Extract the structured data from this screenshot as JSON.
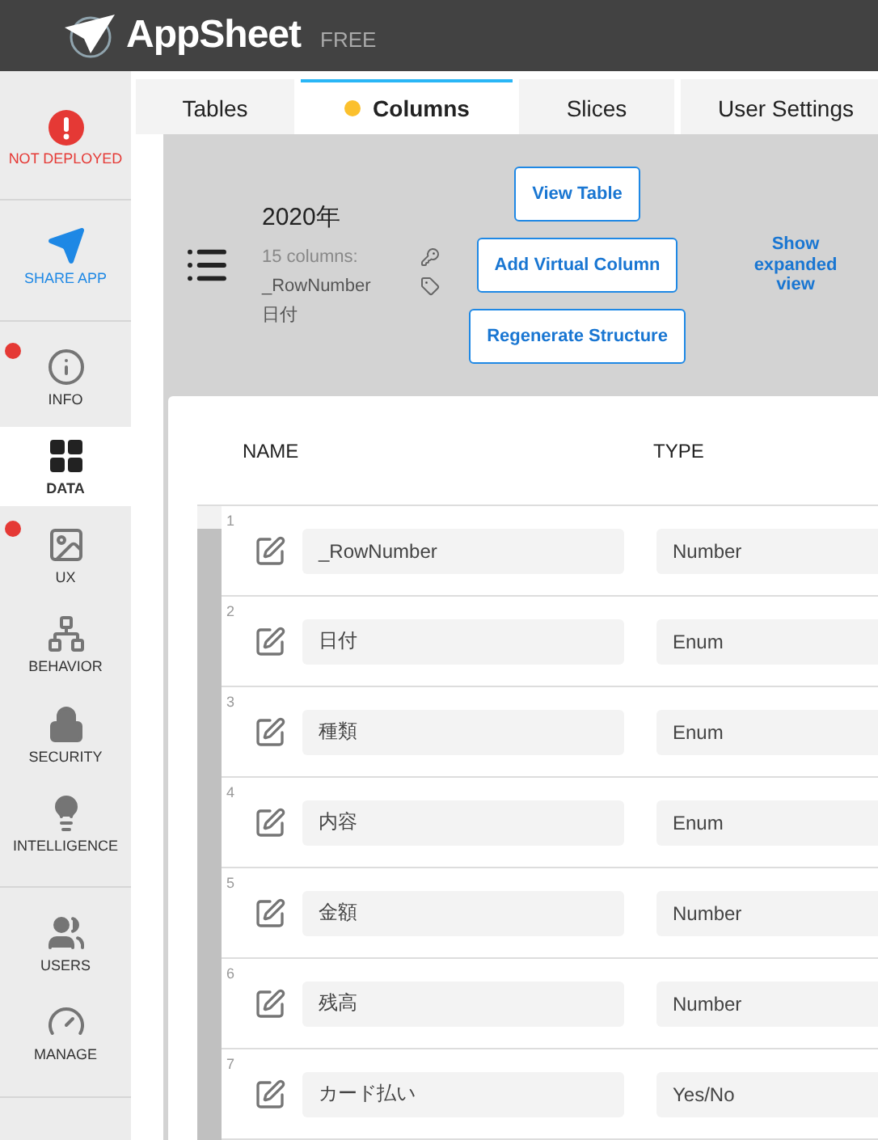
{
  "header": {
    "brand": "AppSheet",
    "plan": "FREE"
  },
  "sidebar": {
    "sections": [
      {
        "items": [
          {
            "kind": "status",
            "label": "NOT DEPLOYED",
            "selected": false,
            "alert": false
          }
        ]
      },
      {
        "items": [
          {
            "kind": "share",
            "label": "SHARE APP",
            "selected": false,
            "alert": false
          }
        ]
      },
      {
        "items": [
          {
            "kind": "info",
            "label": "INFO",
            "selected": false,
            "alert": true
          },
          {
            "kind": "data",
            "label": "DATA",
            "selected": true,
            "alert": false
          },
          {
            "kind": "ux",
            "label": "UX",
            "selected": false,
            "alert": true
          },
          {
            "kind": "behavior",
            "label": "BEHAVIOR",
            "selected": false,
            "alert": false
          },
          {
            "kind": "security",
            "label": "SECURITY",
            "selected": false,
            "alert": false
          },
          {
            "kind": "intelligence",
            "label": "INTELLIGENCE",
            "selected": false,
            "alert": false
          }
        ]
      },
      {
        "items": [
          {
            "kind": "users",
            "label": "USERS",
            "selected": false,
            "alert": false
          },
          {
            "kind": "manage",
            "label": "MANAGE",
            "selected": false,
            "alert": false
          }
        ]
      }
    ]
  },
  "tabs": [
    {
      "label": "Tables",
      "selected": false,
      "modified": false
    },
    {
      "label": "Columns",
      "selected": true,
      "modified": true
    },
    {
      "label": "Slices",
      "selected": false,
      "modified": false
    },
    {
      "label": "User Settings",
      "selected": false,
      "modified": false
    }
  ],
  "table_summary": {
    "title": "2020年",
    "count": "15 columns:",
    "key_column": "_RowNumber",
    "label_column": "日付"
  },
  "buttons": [
    "View Table",
    "Add Virtual Column",
    "Regenerate Structure"
  ],
  "expand_link": "Show expanded view",
  "columns_table": {
    "headers": [
      "NAME",
      "TYPE"
    ],
    "rows": [
      {
        "number": "1",
        "name": "_RowNumber",
        "type": "Number"
      },
      {
        "number": "2",
        "name": "日付",
        "type": "Enum"
      },
      {
        "number": "3",
        "name": "種類",
        "type": "Enum"
      },
      {
        "number": "4",
        "name": "内容",
        "type": "Enum"
      },
      {
        "number": "5",
        "name": "金額",
        "type": "Number"
      },
      {
        "number": "6",
        "name": "残高",
        "type": "Number"
      },
      {
        "number": "7",
        "name": "カード払い",
        "type": "Yes/No"
      }
    ]
  }
}
